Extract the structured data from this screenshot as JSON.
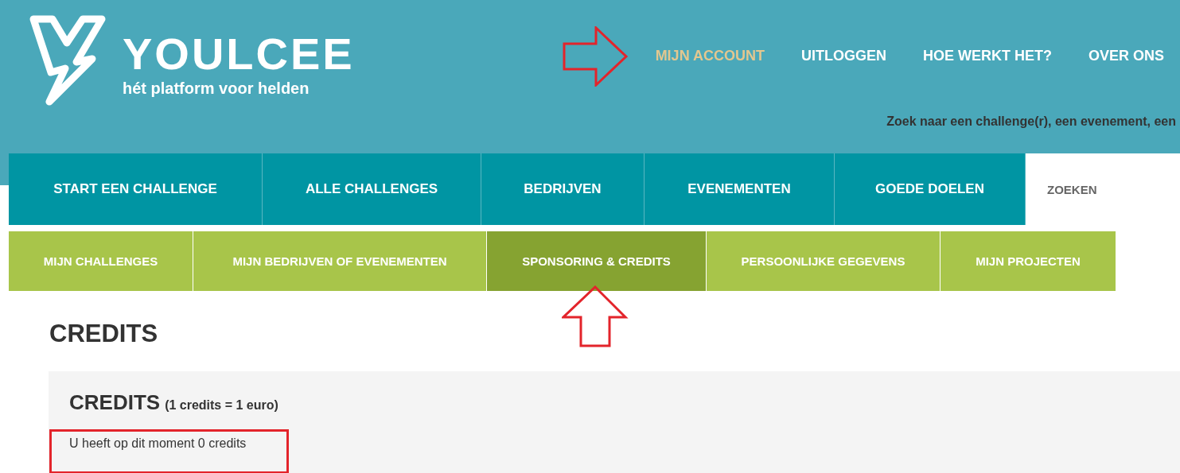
{
  "logo": {
    "name": "YOULCEE",
    "tagline": "hét platform voor helden"
  },
  "top_nav": [
    {
      "label": "MIJN ACCOUNT",
      "selected": true
    },
    {
      "label": "UITLOGGEN",
      "selected": false
    },
    {
      "label": "HOE WERKT HET?",
      "selected": false
    },
    {
      "label": "OVER ONS",
      "selected": false
    }
  ],
  "search_hint": "Zoek naar een challenge(r), een evenement, een",
  "main_tabs": [
    {
      "label": "START EEN CHALLENGE",
      "kind": "link"
    },
    {
      "label": "ALLE CHALLENGES",
      "kind": "link"
    },
    {
      "label": "BEDRIJVEN",
      "kind": "link"
    },
    {
      "label": "EVENEMENTEN",
      "kind": "link"
    },
    {
      "label": "GOEDE DOELEN",
      "kind": "link"
    },
    {
      "label": "ZOEKEN",
      "kind": "search"
    }
  ],
  "account_tabs": [
    {
      "label": "MIJN CHALLENGES",
      "selected": false
    },
    {
      "label": "MIJN BEDRIJVEN OF EVENEMENTEN",
      "selected": false
    },
    {
      "label": "SPONSORING & CREDITS",
      "selected": true
    },
    {
      "label": "PERSOONLIJKE GEGEVENS",
      "selected": false
    },
    {
      "label": "MIJN PROJECTEN",
      "selected": false
    }
  ],
  "page_title": "CREDITS",
  "panel": {
    "title": "CREDITS",
    "note": "(1 credits = 1 euro)",
    "balance": "U heeft op dit moment 0 credits"
  }
}
